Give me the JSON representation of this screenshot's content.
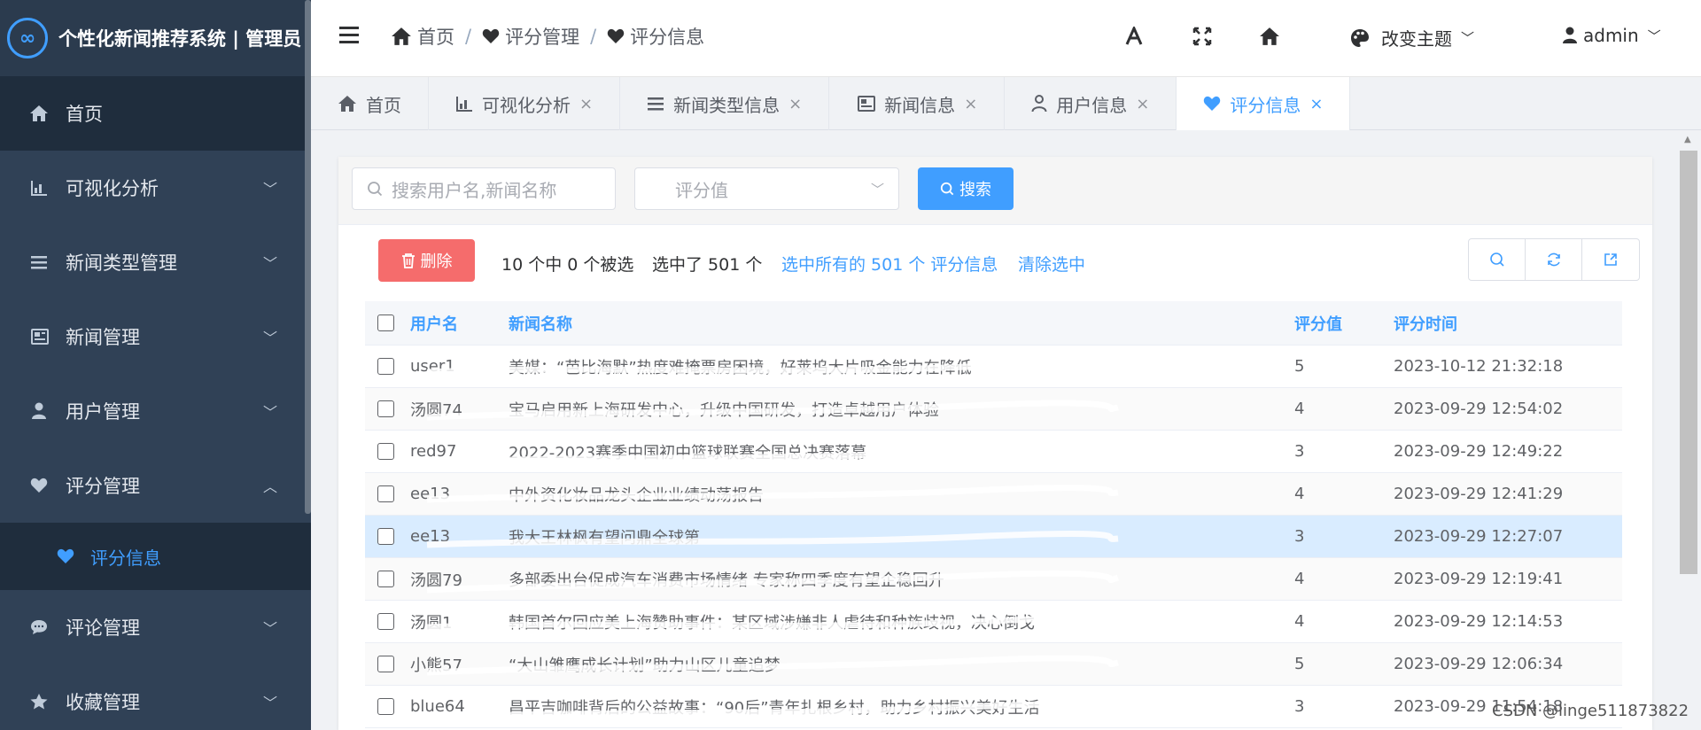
{
  "app": {
    "logo_text": "个性化新闻推荐系统 | 管理员",
    "logo_mark": "∞"
  },
  "sidebar": {
    "items": [
      {
        "label": "首页",
        "icon": "home-icon"
      },
      {
        "label": "可视化分析",
        "icon": "chart-icon"
      },
      {
        "label": "新闻类型管理",
        "icon": "list-icon"
      },
      {
        "label": "新闻管理",
        "icon": "newspaper-icon"
      },
      {
        "label": "用户管理",
        "icon": "user-icon"
      },
      {
        "label": "评分管理",
        "icon": "heart-icon"
      },
      {
        "label": "评论管理",
        "icon": "comment-icon"
      },
      {
        "label": "收藏管理",
        "icon": "star-icon"
      }
    ],
    "sub_item": {
      "label": "评分信息",
      "icon": "heart-icon"
    }
  },
  "header": {
    "breadcrumb": [
      "首页",
      "评分管理",
      "评分信息"
    ],
    "theme_label": "改变主题",
    "user_label": "admin"
  },
  "tabs": [
    {
      "label": "首页",
      "icon": "home-icon",
      "closable": false
    },
    {
      "label": "可视化分析",
      "icon": "chart-icon",
      "closable": true
    },
    {
      "label": "新闻类型信息",
      "icon": "list-icon",
      "closable": true
    },
    {
      "label": "新闻信息",
      "icon": "newspaper-icon",
      "closable": true
    },
    {
      "label": "用户信息",
      "icon": "user-icon",
      "closable": true
    },
    {
      "label": "评分信息",
      "icon": "heart-icon",
      "closable": true,
      "active": true
    }
  ],
  "search": {
    "keyword_placeholder": "搜索用户名,新闻名称",
    "score_placeholder": "评分值",
    "button_label": "搜索"
  },
  "toolbar": {
    "delete_label": "删除",
    "selected_count_text": "10 个中 0 个被选",
    "selected_total_text": "选中了 501 个",
    "select_all_link": "选中所有的 501 个 评分信息",
    "clear_selection_link": "清除选中"
  },
  "table": {
    "headers": {
      "user": "用户名",
      "news": "新闻名称",
      "score": "评分值",
      "time": "评分时间"
    },
    "rows": [
      {
        "user": "user1",
        "news": "美媒：“芭比海默”热度难掩票房困境，好莱坞大片吸金能力在降低",
        "score": "5",
        "time": "2023-10-12 21:32:18"
      },
      {
        "user": "汤圆74",
        "news": "宝马启用新上海研发中心，升级中国研发，打造卓越用户体验",
        "score": "4",
        "time": "2023-09-29 12:54:02"
      },
      {
        "user": "red97",
        "news": "2022-2023赛季中国初中篮球联赛全国总决赛落幕",
        "score": "3",
        "time": "2023-09-29 12:49:22"
      },
      {
        "user": "ee13",
        "news": "中外资化妆品龙头企业业绩动荡报告",
        "score": "4",
        "time": "2023-09-29 12:41:29"
      },
      {
        "user": "ee13",
        "news": "我大王林枫有望问鼎全球第",
        "score": "3",
        "time": "2023-09-29 12:27:07"
      },
      {
        "user": "汤圆79",
        "news": "多部委出台促成汽车消费市场情绪 专家称四季度有望企稳回升",
        "score": "4",
        "time": "2023-09-29 12:19:41"
      },
      {
        "user": "汤圆1",
        "news": "韩国首尔回应美上海赞助事件：某区域涉嫌非人虐待和种族歧视，决心倒戈",
        "score": "4",
        "time": "2023-09-29 12:14:53"
      },
      {
        "user": "小熊57",
        "news": "“大山雏鹰成长计划”助力山区儿童追梦",
        "score": "5",
        "time": "2023-09-29 12:06:34"
      },
      {
        "user": "blue64",
        "news": "昌平吉咖啡背后的公益故事：“90后”青年扎根乡村，助力乡村振兴美好生活",
        "score": "3",
        "time": "2023-09-29 11:54:18"
      }
    ]
  },
  "watermark": "CSDN @linge511873822",
  "colors": {
    "sidebar": "#304156",
    "accent": "#409eff",
    "danger": "#f56c6c",
    "highlight": "#d9ecff"
  }
}
